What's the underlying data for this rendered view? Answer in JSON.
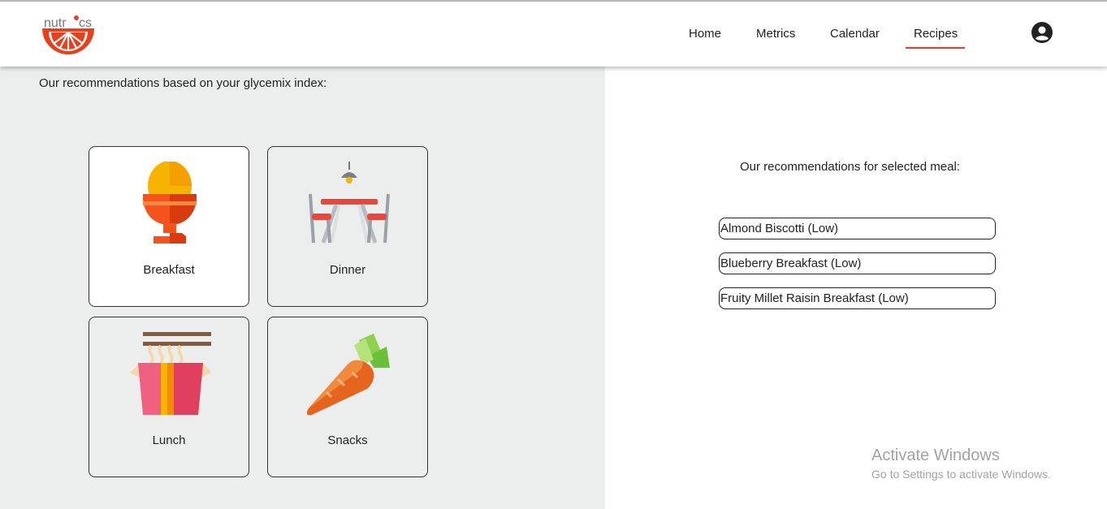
{
  "brand": {
    "name": "nutrics",
    "accent": "#e8401c"
  },
  "nav": {
    "items": [
      {
        "label": "Home"
      },
      {
        "label": "Metrics"
      },
      {
        "label": "Calendar"
      },
      {
        "label": "Recipes",
        "active": true
      }
    ],
    "account_icon": "account-circle-icon"
  },
  "left": {
    "heading": "Our recommendations based on your glycemix index:",
    "meals": [
      {
        "label": "Breakfast",
        "icon": "egg-cup-icon",
        "selected": true
      },
      {
        "label": "Dinner",
        "icon": "dining-table-icon",
        "selected": false
      },
      {
        "label": "Lunch",
        "icon": "noodle-box-icon",
        "selected": false
      },
      {
        "label": "Snacks",
        "icon": "carrot-icon",
        "selected": false
      }
    ]
  },
  "right": {
    "heading": "Our recommendations for selected meal:",
    "recipes": [
      "Almond Biscotti (Low)",
      "Blueberry Breakfast (Low)",
      "Fruity Millet Raisin Breakfast (Low)"
    ]
  },
  "watermark": {
    "title": "Activate Windows",
    "subtitle": "Go to Settings to activate Windows."
  }
}
